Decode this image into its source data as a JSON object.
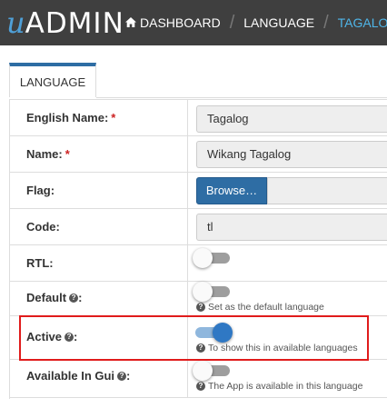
{
  "brand": {
    "prefix": "u",
    "name": "ADMIN"
  },
  "breadcrumb": {
    "items": [
      {
        "label": "DASHBOARD",
        "icon": "home-icon"
      },
      {
        "label": "LANGUAGE"
      },
      {
        "label": "TAGALOG"
      }
    ],
    "separator": "/"
  },
  "tabs": [
    {
      "label": "LANGUAGE"
    }
  ],
  "form": {
    "english_name": {
      "label": "English Name:",
      "required": "*",
      "value": "Tagalog"
    },
    "name": {
      "label": "Name:",
      "required": "*",
      "value": "Wikang Tagalog"
    },
    "flag": {
      "label": "Flag:",
      "button": "Browse…",
      "value": ""
    },
    "code": {
      "label": "Code:",
      "value": "tl"
    },
    "rtl": {
      "label": "RTL:",
      "checked": false
    },
    "default": {
      "label": "Default",
      "suffix": ":",
      "checked": false,
      "help": "Set as the default language"
    },
    "active": {
      "label": "Active",
      "suffix": ":",
      "checked": true,
      "help": "To show this in available languages"
    },
    "available_in_gui": {
      "label": "Available In Gui",
      "suffix": ":",
      "checked": false,
      "help": "The App is available in this language"
    }
  },
  "colors": {
    "navbar": "#3f3f3f",
    "accent": "#2e6da4",
    "active_crumb": "#4fb6e9",
    "highlight": "#e01b1b"
  }
}
